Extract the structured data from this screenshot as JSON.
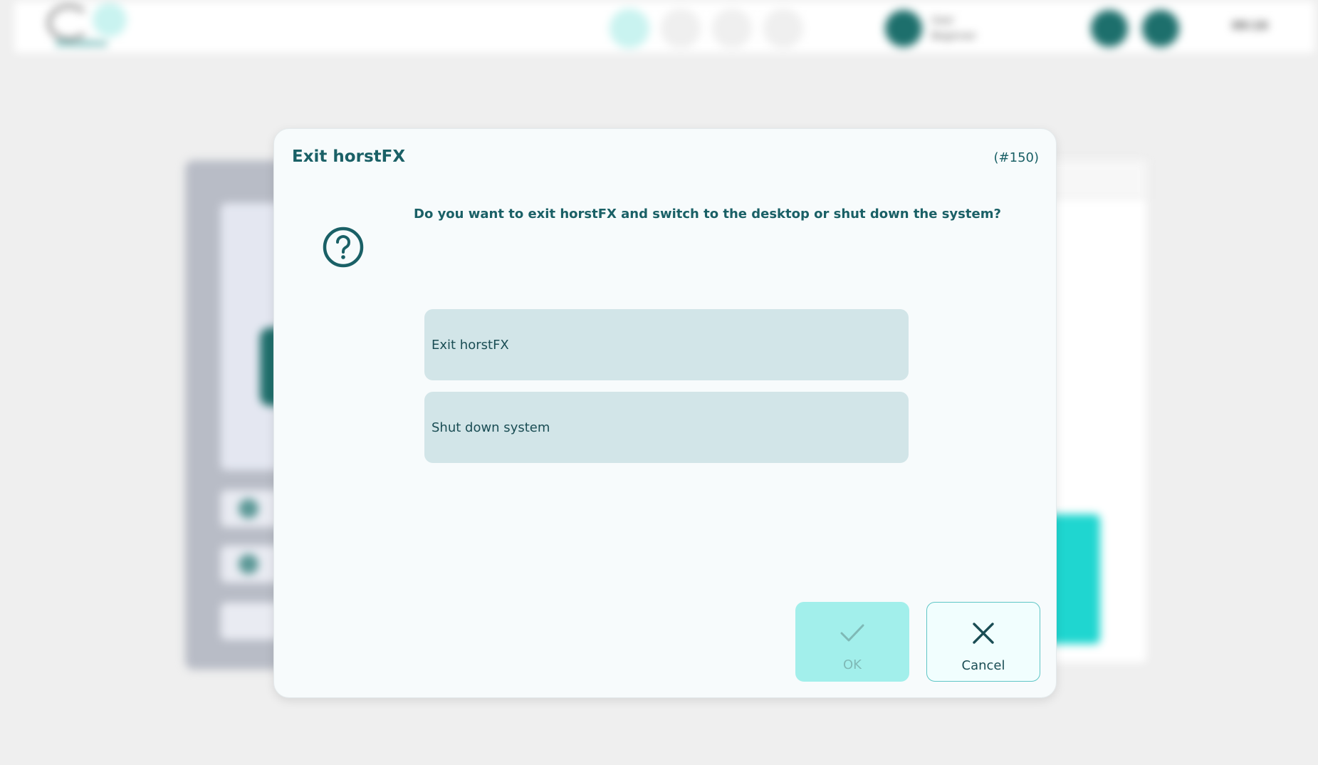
{
  "background_app": {
    "logo_caption": "Simulation",
    "user": {
      "line1": "User",
      "line2": "Beginner"
    },
    "clock": "09:16"
  },
  "dialog": {
    "title": "Exit horstFX",
    "id": "(#150)",
    "icon": "question-circle-icon",
    "message": "Do you want to exit horstFX and switch to the desktop or shut down the system?",
    "options": [
      {
        "label": "Exit horstFX"
      },
      {
        "label": "Shut down system"
      }
    ],
    "ok_label": "OK",
    "cancel_label": "Cancel",
    "colors": {
      "accent": "#1a6066",
      "option_bg": "#d2e5e8",
      "ok_bg": "#a2efeb",
      "cancel_border": "#5fc6c6"
    }
  }
}
